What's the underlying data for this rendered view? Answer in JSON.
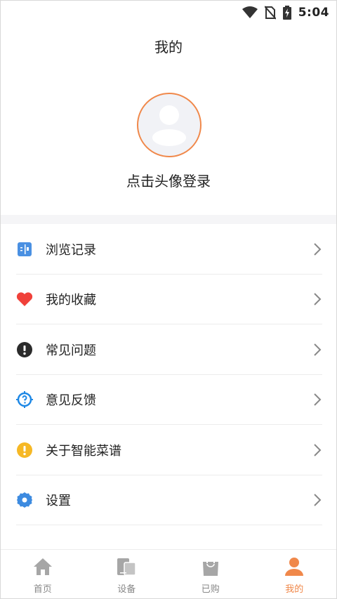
{
  "status_bar": {
    "time": "5:04"
  },
  "header": {
    "title": "我的"
  },
  "profile": {
    "login_label": "点击头像登录"
  },
  "menu": [
    {
      "label": "浏览记录",
      "icon": "history-icon",
      "color": "#4a90e2"
    },
    {
      "label": "我的收藏",
      "icon": "heart-icon",
      "color": "#f0413a"
    },
    {
      "label": "常见问题",
      "icon": "exclamation-icon",
      "color": "#2b2b2b"
    },
    {
      "label": "意见反馈",
      "icon": "feedback-icon",
      "color": "#1e88e5"
    },
    {
      "label": "关于智能菜谱",
      "icon": "info-icon",
      "color": "#f6b825"
    },
    {
      "label": "设置",
      "icon": "gear-icon",
      "color": "#3d8be0"
    }
  ],
  "tabs": [
    {
      "label": "首页",
      "icon": "home-icon",
      "active": false
    },
    {
      "label": "设备",
      "icon": "device-icon",
      "active": false
    },
    {
      "label": "已购",
      "icon": "shopping-bag-icon",
      "active": false
    },
    {
      "label": "我的",
      "icon": "person-icon",
      "active": true
    }
  ],
  "colors": {
    "accent": "#f0884a",
    "inactive": "#a6a6a6"
  }
}
